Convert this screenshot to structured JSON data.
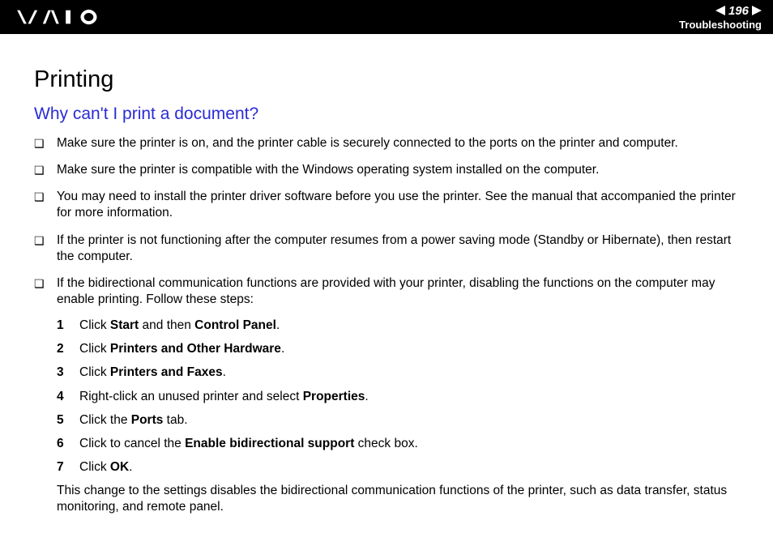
{
  "header": {
    "page_number": "196",
    "section": "Troubleshooting"
  },
  "content": {
    "title": "Printing",
    "question": "Why can't I print a document?",
    "bullets": [
      "Make sure the printer is on, and the printer cable is securely connected to the ports on the printer and computer.",
      "Make sure the printer is compatible with the Windows operating system installed on the computer.",
      "You may need to install the printer driver software before you use the printer. See the manual that accompanied the printer for more information.",
      "If the printer is not functioning after the computer resumes from a power saving mode (Standby or Hibernate), then restart the computer.",
      "If the bidirectional communication functions are provided with your printer, disabling the functions on the computer may enable printing. Follow these steps:"
    ],
    "steps": [
      {
        "pre": "Click ",
        "b1": "Start",
        "mid": " and then ",
        "b2": "Control Panel",
        "post": "."
      },
      {
        "pre": "Click ",
        "b1": "Printers and Other Hardware",
        "post": "."
      },
      {
        "pre": "Click ",
        "b1": "Printers and Faxes",
        "post": "."
      },
      {
        "pre": "Right-click an unused printer and select ",
        "b1": "Properties",
        "post": "."
      },
      {
        "pre": "Click the ",
        "b1": "Ports",
        "post": " tab."
      },
      {
        "pre": "Click to cancel the ",
        "b1": "Enable bidirectional support",
        "post": " check box."
      },
      {
        "pre": "Click ",
        "b1": "OK",
        "post": "."
      }
    ],
    "closing": "This change to the settings disables the bidirectional communication functions of the printer, such as data transfer, status monitoring, and remote panel."
  }
}
